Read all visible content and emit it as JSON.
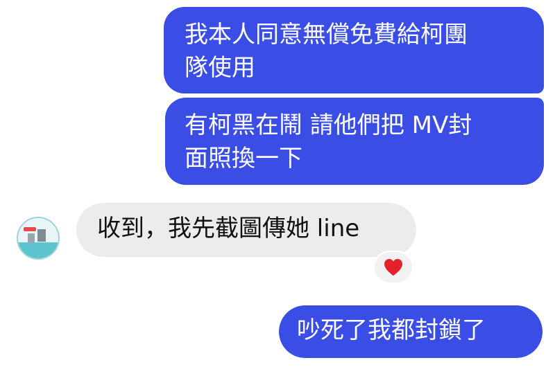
{
  "messages": [
    {
      "text": "我本人同意無償免費給柯團\n隊使用"
    },
    {
      "text": "有柯黑在鬧 請他們把 MV封\n面照換一下"
    },
    {
      "text": "收到，我先截圖傳她 line"
    },
    {
      "text": "吵死了我都封鎖了"
    }
  ],
  "reaction": {
    "icon": "heart-icon",
    "color": "#e5212b"
  },
  "colors": {
    "outgoing_bubble": "#3a4ee6",
    "incoming_bubble": "#ececec"
  }
}
